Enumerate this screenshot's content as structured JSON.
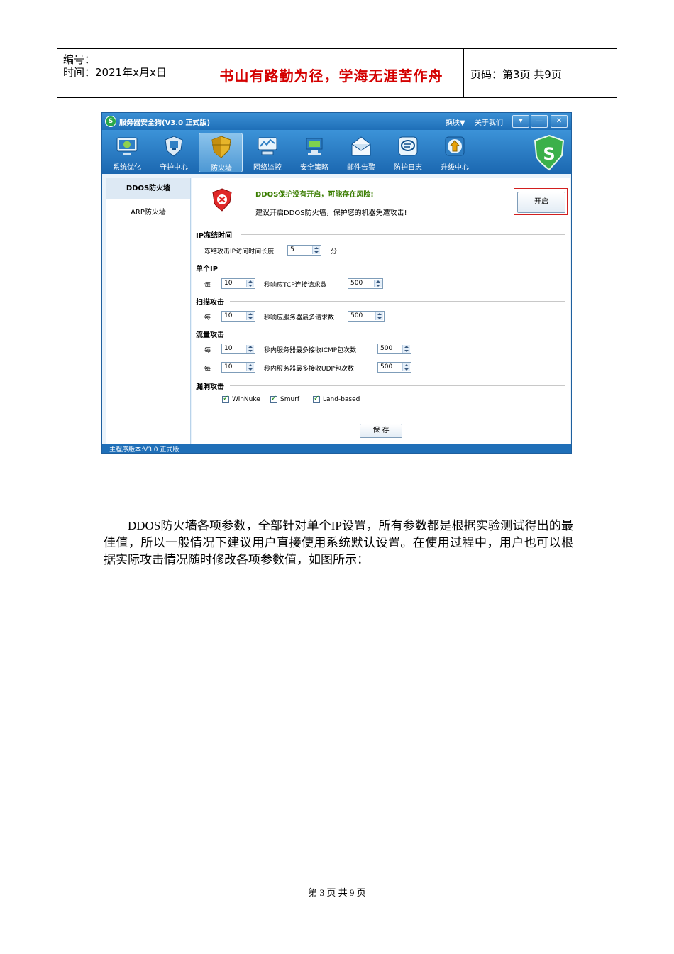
{
  "header": {
    "number_label": "编号：",
    "time_label": "时间：2021年x月x日",
    "motto": "书山有路勤为径，学海无涯苦作舟",
    "page_info": "页码：第3页 共9页"
  },
  "app": {
    "title": "服务器安全狗(V3.0 正式版)",
    "skin_menu": "换肤▼",
    "about_link": "关于我们",
    "window_buttons": [
      "▾",
      "—",
      "✕"
    ],
    "toolbar": [
      {
        "label": "系统优化",
        "icon": "monitor-icon"
      },
      {
        "label": "守护中心",
        "icon": "guard-icon"
      },
      {
        "label": "防火墙",
        "icon": "shield-icon"
      },
      {
        "label": "网络监控",
        "icon": "network-icon"
      },
      {
        "label": "安全策略",
        "icon": "policy-icon"
      },
      {
        "label": "邮件告警",
        "icon": "mail-icon"
      },
      {
        "label": "防护日志",
        "icon": "log-icon"
      },
      {
        "label": "升级中心",
        "icon": "upgrade-icon"
      }
    ],
    "sidebar": [
      "DDOS防火墙",
      "ARP防火墙"
    ],
    "alert": {
      "title": "DDOS保护没有开启，可能存在风险!",
      "desc": "建议开启DDOS防火墙，保护您的机器免遭攻击!",
      "button": "开启"
    },
    "sections": {
      "freeze": {
        "title": "IP冻结时间",
        "label": "冻结攻击IP访问时间长度",
        "value": "5",
        "unit": "分"
      },
      "single_ip": {
        "title": "单个IP",
        "prefix": "每",
        "seconds": "10",
        "label": "秒响应TCP连接请求数",
        "value": "500"
      },
      "scan": {
        "title": "扫描攻击",
        "prefix": "每",
        "seconds": "10",
        "label": "秒响应服务器最多请求数",
        "value": "500"
      },
      "flood": {
        "title": "流量攻击",
        "rows": [
          {
            "prefix": "每",
            "seconds": "10",
            "label": "秒内服务器最多接收ICMP包次数",
            "value": "500"
          },
          {
            "prefix": "每",
            "seconds": "10",
            "label": "秒内服务器最多接收UDP包次数",
            "value": "500"
          }
        ]
      },
      "vuln": {
        "title": "漏洞攻击",
        "options": [
          "WinNuke",
          "Smurf",
          "Land-based"
        ]
      }
    },
    "save_button": "保 存",
    "status": "主程序版本:V3.0 正式版"
  },
  "paragraph": "DDOS防火墙各项参数，全部针对单个IP设置，所有参数都是根据实验测试得出的最佳值，所以一般情况下建议用户直接使用系统默认设置。在使用过程中，用户也可以根据实际攻击情况随时修改各项参数值，如图所示：",
  "footer": "第 3 页 共 9 页"
}
